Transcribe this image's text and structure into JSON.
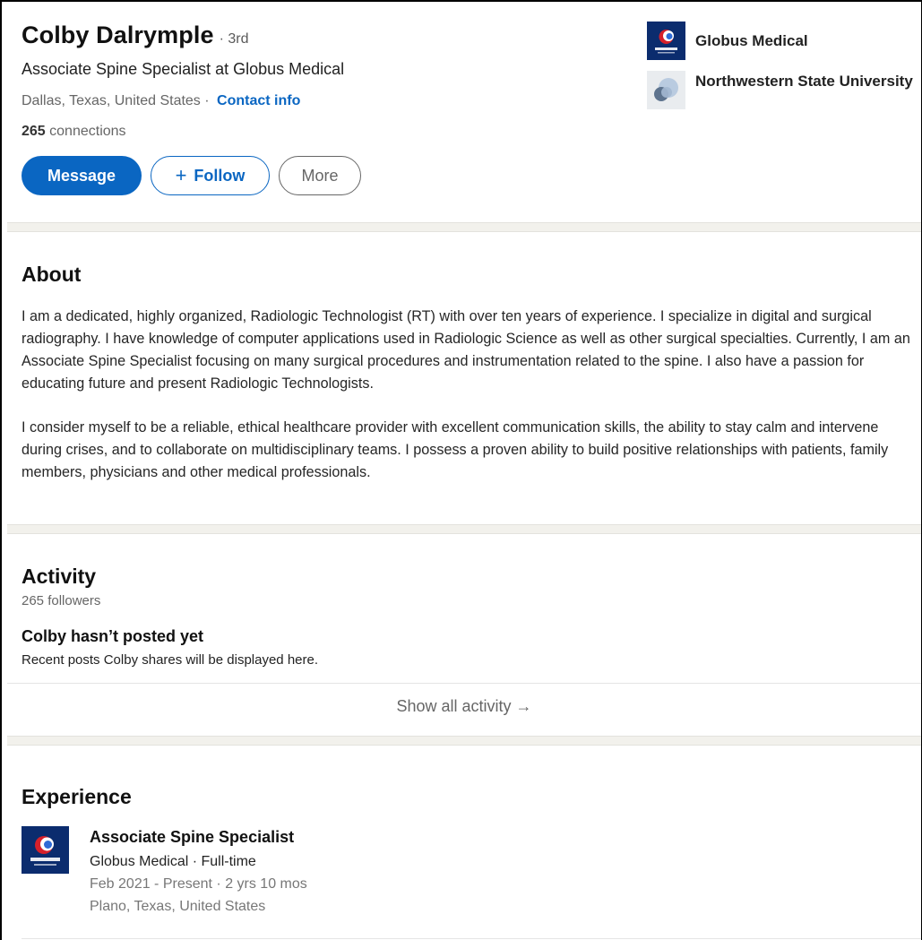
{
  "profile": {
    "name": "Colby Dalrymple",
    "degree": "· 3rd",
    "headline": "Associate Spine Specialist at Globus Medical",
    "location": "Dallas, Texas, United States ·",
    "contact_info": "Contact info",
    "connections_count": "265",
    "connections_label": "connections"
  },
  "actions": {
    "message": "Message",
    "follow_plus": "+",
    "follow": "Follow",
    "more": "More"
  },
  "side": {
    "company": "Globus Medical",
    "school": "Northwestern State University"
  },
  "about": {
    "title": "About",
    "paragraph_1": "I am a dedicated, highly organized, Radiologic Technologist (RT) with over ten years of experience. I specialize in digital and surgical radiography. I have knowledge of computer applications used in Radiologic Science as well as other surgical specialties. Currently, I am an Associate Spine Specialist focusing on many surgical procedures and instrumentation related to the spine. I also have a passion for educating future and present Radiologic Technologists.",
    "paragraph_2": "I consider myself to be a reliable, ethical healthcare provider with excellent communication skills, the ability to stay calm and intervene during crises, and to collaborate on multidisciplinary teams. I possess a proven ability to build positive relationships with patients, family members, physicians and other medical professionals."
  },
  "activity": {
    "title": "Activity",
    "followers": "265 followers",
    "empty_title": "Colby hasn’t posted yet",
    "empty_subtitle": "Recent posts Colby shares will be displayed here.",
    "show_all": "Show all activity →"
  },
  "experience": {
    "title": "Experience",
    "items": [
      {
        "title": "Associate Spine Specialist",
        "company": "Globus Medical · Full-time",
        "dates": "Feb 2021 - Present · 2 yrs 10 mos",
        "location": "Plano, Texas, United States"
      }
    ]
  },
  "colors": {
    "accent": "#0a66c2",
    "globus_navy": "#0b2c6e",
    "globus_red": "#d6202a"
  },
  "icons": {
    "company_logo": "globus-medical-logo",
    "school_logo": "northwestern-state-logo"
  }
}
